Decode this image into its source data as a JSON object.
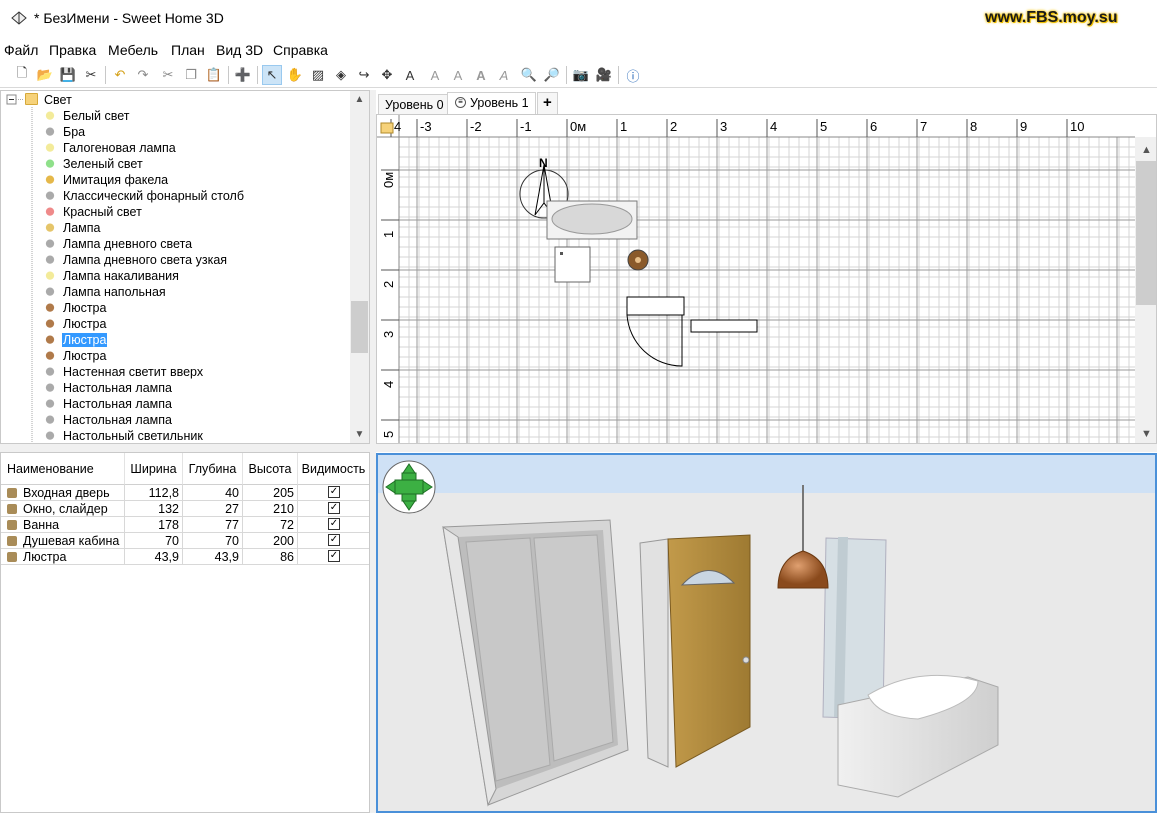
{
  "window": {
    "title": "* БезИмени - Sweet Home 3D",
    "watermark": "www.FBS.moy.su"
  },
  "menu": [
    "Файл",
    "Правка",
    "Мебель",
    "План",
    "Вид 3D",
    "Справка"
  ],
  "toolbar": {
    "icons": [
      "new-home-icon",
      "open-icon",
      "save-icon",
      "preferences-icon",
      "undo-icon",
      "redo-icon",
      "cut-icon",
      "copy-icon",
      "paste-icon",
      "add-furniture-icon",
      "select-mode-icon",
      "pan-mode-icon",
      "create-walls-icon",
      "create-rooms-icon",
      "create-polylines-icon",
      "create-dimensions-icon",
      "add-text-icon",
      "increase-text-icon",
      "decrease-text-icon",
      "bold-text-icon",
      "italic-text-icon",
      "zoom-in-icon",
      "zoom-out-icon",
      "create-photo-icon",
      "create-video-icon",
      "help-icon"
    ]
  },
  "catalog": {
    "root": "Свет",
    "items": [
      {
        "label": "Белый свет",
        "icon": "bulb-icon"
      },
      {
        "label": "Бра",
        "icon": "sconce-icon"
      },
      {
        "label": "Галогеновая лампа",
        "icon": "bulb-icon"
      },
      {
        "label": "Зеленый свет",
        "icon": "green-bulb-icon"
      },
      {
        "label": "Имитация факела",
        "icon": "torch-icon"
      },
      {
        "label": "Классический фонарный столб",
        "icon": "lamppost-icon"
      },
      {
        "label": "Красный свет",
        "icon": "red-bulb-icon"
      },
      {
        "label": "Лампа",
        "icon": "lamp-icon"
      },
      {
        "label": "Лампа дневного света",
        "icon": "fluorescent-icon"
      },
      {
        "label": "Лампа дневного света узкая",
        "icon": "fluorescent-narrow-icon"
      },
      {
        "label": "Лампа накаливания",
        "icon": "bulb-icon"
      },
      {
        "label": "Лампа напольная",
        "icon": "floor-lamp-icon"
      },
      {
        "label": "Люстра",
        "icon": "chandelier-icon"
      },
      {
        "label": "Люстра",
        "icon": "chandelier-icon"
      },
      {
        "label": "Люстра",
        "icon": "chandelier-icon",
        "selected": true
      },
      {
        "label": "Люстра",
        "icon": "chandelier-icon"
      },
      {
        "label": "Настенная светит вверх",
        "icon": "wall-uplight-icon"
      },
      {
        "label": "Настольная лампа",
        "icon": "desk-lamp-icon"
      },
      {
        "label": "Настольная лампа",
        "icon": "desk-lamp-icon"
      },
      {
        "label": "Настольная лампа",
        "icon": "desk-lamp-icon"
      },
      {
        "label": "Настольный светильник",
        "icon": "table-light-icon"
      }
    ]
  },
  "furniture_table": {
    "headers": [
      "Наименование",
      "Ширина",
      "Глубина",
      "Высота",
      "Видимость"
    ],
    "rows": [
      {
        "name": "Входная дверь",
        "width": "112,8",
        "depth": "40",
        "height": "205",
        "visible": true
      },
      {
        "name": "Окно, слайдер",
        "width": "132",
        "depth": "27",
        "height": "210",
        "visible": true
      },
      {
        "name": "Ванна",
        "width": "178",
        "depth": "77",
        "height": "72",
        "visible": true
      },
      {
        "name": "Душевая кабина",
        "width": "70",
        "depth": "70",
        "height": "200",
        "visible": true
      },
      {
        "name": "Люстра",
        "width": "43,9",
        "depth": "43,9",
        "height": "86",
        "visible": true
      }
    ]
  },
  "plan": {
    "tabs": [
      "Уровень 0",
      "Уровень 1"
    ],
    "active_tab": "Уровень 1",
    "add_tab": "+",
    "ruler_x": [
      "4",
      "-3",
      "-2",
      "-1",
      "0м",
      "1",
      "2",
      "3",
      "4",
      "5",
      "6",
      "7",
      "8",
      "9",
      "10"
    ],
    "ruler_y": [
      "0м",
      "1",
      "2",
      "3",
      "4",
      "5"
    ],
    "compass": "N"
  },
  "colors": {
    "selection": "#3399ff",
    "sky": "#cfe1f5",
    "floor": "#e8e8e8",
    "door": "#b08a3e",
    "view_border": "#4a90d9"
  }
}
